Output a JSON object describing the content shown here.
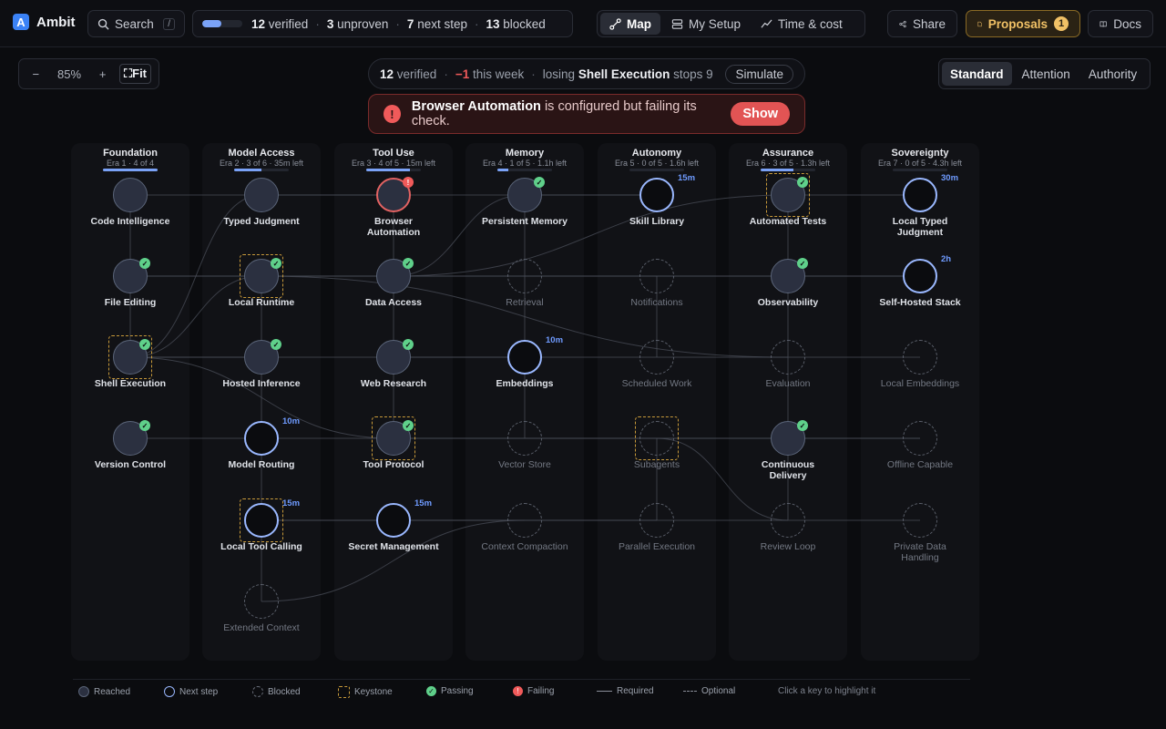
{
  "app": {
    "name": "Ambit",
    "logo_letter": "A"
  },
  "search": {
    "label": "Search",
    "shortcut": "/"
  },
  "stats": {
    "progress": 0.48,
    "verified_num": "12",
    "verified_label": "verified",
    "unproven_num": "3",
    "unproven_label": "unproven",
    "next_num": "7",
    "next_label": "next step",
    "blocked_num": "13",
    "blocked_label": "blocked"
  },
  "view_tabs": [
    {
      "label": "Map",
      "icon": "map-icon",
      "active": true
    },
    {
      "label": "My Setup",
      "icon": "setup-icon",
      "active": false
    },
    {
      "label": "Time & cost",
      "icon": "chart-icon",
      "active": false
    }
  ],
  "header_actions": {
    "share": "Share",
    "proposals": "Proposals",
    "proposals_count": "1",
    "docs": "Docs"
  },
  "zoom": {
    "minus": "−",
    "value": "85%",
    "plus": "+",
    "fit": "Fit"
  },
  "summary": {
    "verified_num": "12",
    "verified_label": "verified",
    "delta": "−1",
    "delta_label": "this week",
    "losing_prefix": "losing",
    "losing_name": "Shell Execution",
    "losing_suffix": "stops 9",
    "simulate": "Simulate"
  },
  "alert": {
    "icon": "!",
    "name": "Browser Automation",
    "text": "is configured but failing its check.",
    "action": "Show"
  },
  "modes": [
    {
      "label": "Standard",
      "active": true
    },
    {
      "label": "Attention",
      "active": false
    },
    {
      "label": "Authority",
      "active": false
    }
  ],
  "columns": [
    {
      "title": "Foundation",
      "sub": "Era 1 · 4 of 4",
      "progress": 1.0
    },
    {
      "title": "Model Access",
      "sub": "Era 2 · 3 of 6 · 35m left",
      "progress": 0.5
    },
    {
      "title": "Tool Use",
      "sub": "Era 3 · 4 of 5 · 15m left",
      "progress": 0.8
    },
    {
      "title": "Memory",
      "sub": "Era 4 · 1 of 5 · 1.1h left",
      "progress": 0.2
    },
    {
      "title": "Autonomy",
      "sub": "Era 5 · 0 of 5 · 1.6h left",
      "progress": 0.0
    },
    {
      "title": "Assurance",
      "sub": "Era 6 · 3 of 5 · 1.3h left",
      "progress": 0.6
    },
    {
      "title": "Sovereignty",
      "sub": "Era 7 · 0 of 5 · 4.3h left",
      "progress": 0.0
    }
  ],
  "nodes": [
    {
      "id": "code-intelligence",
      "label": "Code Intelligence",
      "state": "reached",
      "col": 0,
      "row": 0
    },
    {
      "id": "file-editing",
      "label": "File Editing",
      "state": "reached",
      "col": 0,
      "row": 1,
      "check": "pass"
    },
    {
      "id": "shell-execution",
      "label": "Shell Execution",
      "state": "reached",
      "col": 0,
      "row": 2,
      "check": "pass",
      "keystone": true
    },
    {
      "id": "version-control",
      "label": "Version Control",
      "state": "reached",
      "col": 0,
      "row": 3,
      "check": "pass"
    },
    {
      "id": "typed-judgment",
      "label": "Typed Judgment",
      "state": "reached",
      "col": 1,
      "row": 0
    },
    {
      "id": "local-runtime",
      "label": "Local Runtime",
      "state": "reached",
      "col": 1,
      "row": 1,
      "check": "pass",
      "keystone": true
    },
    {
      "id": "hosted-inference",
      "label": "Hosted Inference",
      "state": "reached",
      "col": 1,
      "row": 2,
      "check": "pass"
    },
    {
      "id": "model-routing",
      "label": "Model Routing",
      "state": "next",
      "col": 1,
      "row": 3,
      "time": "10m"
    },
    {
      "id": "local-tool-calling",
      "label": "Local Tool Calling",
      "state": "next",
      "col": 1,
      "row": 4,
      "time": "15m",
      "keystone": true
    },
    {
      "id": "extended-context",
      "label": "Extended Context",
      "state": "blocked",
      "col": 1,
      "row": 5
    },
    {
      "id": "browser-automation",
      "label": "Browser Automation",
      "state": "failing",
      "col": 2,
      "row": 0,
      "check": "fail"
    },
    {
      "id": "data-access",
      "label": "Data Access",
      "state": "reached",
      "col": 2,
      "row": 1,
      "check": "pass"
    },
    {
      "id": "web-research",
      "label": "Web Research",
      "state": "reached",
      "col": 2,
      "row": 2,
      "check": "pass"
    },
    {
      "id": "tool-protocol",
      "label": "Tool Protocol",
      "state": "reached",
      "col": 2,
      "row": 3,
      "check": "pass",
      "keystone": true
    },
    {
      "id": "secret-management",
      "label": "Secret Management",
      "state": "next",
      "col": 2,
      "row": 4,
      "time": "15m"
    },
    {
      "id": "persistent-memory",
      "label": "Persistent Memory",
      "state": "reached",
      "col": 3,
      "row": 0,
      "check": "pass"
    },
    {
      "id": "retrieval",
      "label": "Retrieval",
      "state": "blocked",
      "col": 3,
      "row": 1
    },
    {
      "id": "embeddings",
      "label": "Embeddings",
      "state": "next",
      "col": 3,
      "row": 2,
      "time": "10m"
    },
    {
      "id": "vector-store",
      "label": "Vector Store",
      "state": "blocked",
      "col": 3,
      "row": 3
    },
    {
      "id": "context-compaction",
      "label": "Context Compaction",
      "state": "blocked",
      "col": 3,
      "row": 4
    },
    {
      "id": "skill-library",
      "label": "Skill Library",
      "state": "next",
      "col": 4,
      "row": 0,
      "time": "15m"
    },
    {
      "id": "notifications",
      "label": "Notifications",
      "state": "blocked",
      "col": 4,
      "row": 1
    },
    {
      "id": "scheduled-work",
      "label": "Scheduled Work",
      "state": "blocked",
      "col": 4,
      "row": 2
    },
    {
      "id": "subagents",
      "label": "Subagents",
      "state": "blocked",
      "col": 4,
      "row": 3,
      "keystone": true
    },
    {
      "id": "parallel-execution",
      "label": "Parallel Execution",
      "state": "blocked",
      "col": 4,
      "row": 4
    },
    {
      "id": "automated-tests",
      "label": "Automated Tests",
      "state": "reached",
      "col": 5,
      "row": 0,
      "check": "pass",
      "keystone": true
    },
    {
      "id": "observability",
      "label": "Observability",
      "state": "reached",
      "col": 5,
      "row": 1,
      "check": "pass"
    },
    {
      "id": "evaluation",
      "label": "Evaluation",
      "state": "blocked",
      "col": 5,
      "row": 2
    },
    {
      "id": "continuous-delivery",
      "label": "Continuous Delivery",
      "state": "reached",
      "col": 5,
      "row": 3,
      "check": "pass"
    },
    {
      "id": "review-loop",
      "label": "Review Loop",
      "state": "blocked",
      "col": 5,
      "row": 4
    },
    {
      "id": "local-typed-judgment",
      "label": "Local Typed Judgment",
      "state": "next",
      "col": 6,
      "row": 0,
      "time": "30m"
    },
    {
      "id": "self-hosted-stack",
      "label": "Self-Hosted Stack",
      "state": "next",
      "col": 6,
      "row": 1,
      "time": "2h"
    },
    {
      "id": "local-embeddings",
      "label": "Local Embeddings",
      "state": "blocked",
      "col": 6,
      "row": 2
    },
    {
      "id": "offline-capable",
      "label": "Offline Capable",
      "state": "blocked",
      "col": 6,
      "row": 3
    },
    {
      "id": "private-data-handling",
      "label": "Private Data Handling",
      "state": "blocked",
      "col": 6,
      "row": 4
    }
  ],
  "legend": {
    "reached": "Reached",
    "next": "Next step",
    "blocked": "Blocked",
    "keystone": "Keystone",
    "passing": "Passing",
    "failing": "Failing",
    "required": "Required",
    "optional": "Optional",
    "hint": "Click a key to highlight it"
  },
  "colors": {
    "accent": "#7aa2f7",
    "failing": "#f05a5a",
    "passing": "#5fd08a",
    "keystone": "#c89a3a",
    "warning_bg": "#2a2214"
  }
}
